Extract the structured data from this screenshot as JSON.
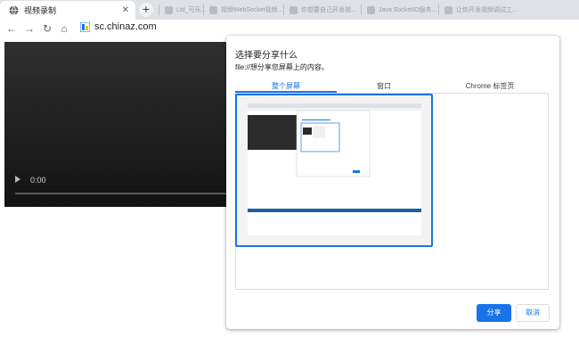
{
  "browser": {
    "active_tab": {
      "title": "视频录制",
      "close": "✕"
    },
    "new_tab": "+",
    "background_tabs": [
      {
        "label": "Ltd_可乐..."
      },
      {
        "label": "视频WebSocket视频..."
      },
      {
        "label": "你想要自己开发视..."
      },
      {
        "label": "Java SocketIO服务..."
      },
      {
        "label": "让你开发视频调试工..."
      }
    ],
    "nav": {
      "back": "←",
      "forward": "→",
      "reload": "↻",
      "home": "⌂"
    },
    "address": "sc.chinaz.com"
  },
  "video": {
    "time": "0:00"
  },
  "dialog": {
    "title": "选择要分享什么",
    "subtitle": "file://想分享您屏幕上的内容。",
    "tabs": [
      {
        "label": "整个屏幕"
      },
      {
        "label": "窗口"
      },
      {
        "label": "Chrome 标签页"
      }
    ],
    "share_button": "分享",
    "cancel_button": "取消"
  },
  "colors": {
    "accent": "#1a73e8",
    "tabstrip": "#dee1e6",
    "video_bg": "#262626"
  }
}
